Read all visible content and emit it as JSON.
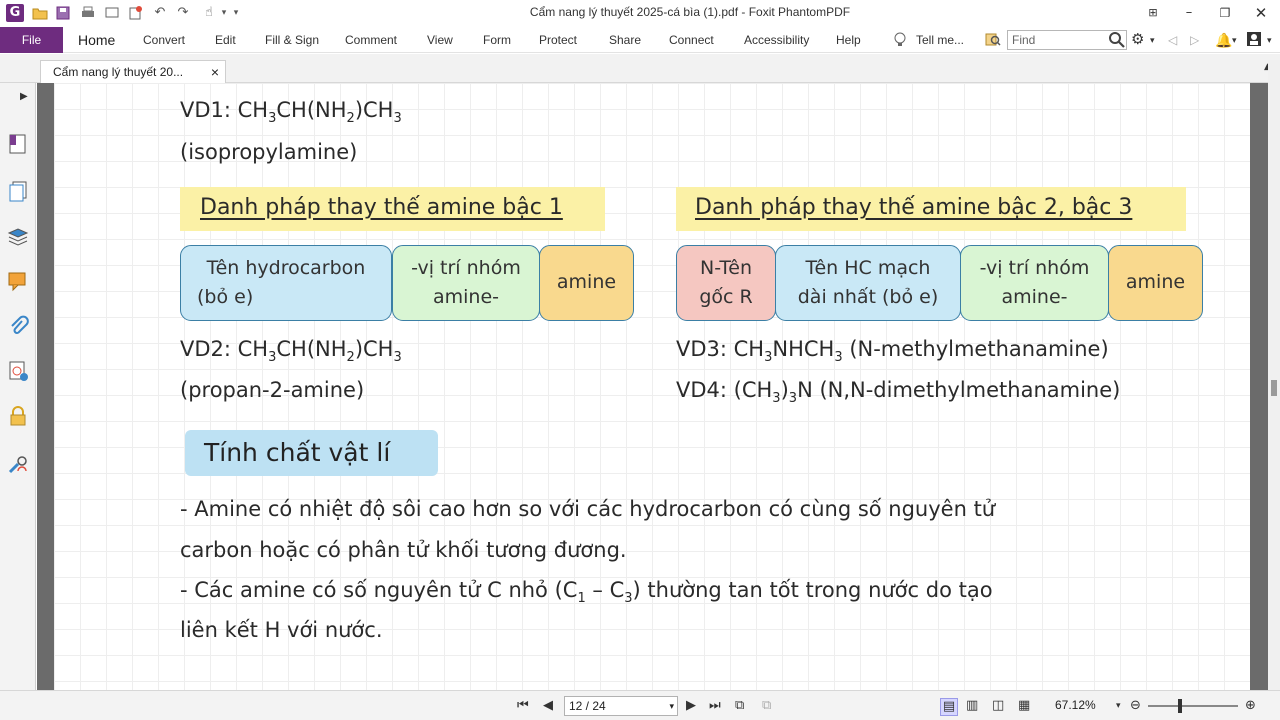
{
  "app": {
    "icon_letter": "G",
    "window_title": "Cẩm nang lý thuyết 2025-cá bìa (1).pdf - Foxit PhantomPDF"
  },
  "menu": {
    "file": "File",
    "items": [
      "Home",
      "Convert",
      "Edit",
      "Fill & Sign",
      "Comment",
      "View",
      "Form",
      "Protect",
      "Share",
      "Connect",
      "Accessibility",
      "Help"
    ],
    "tell_me": "Tell me...",
    "find_placeholder": "Find"
  },
  "tab": {
    "title": "Cẩm nang lý thuyết 20...",
    "close": "×"
  },
  "content": {
    "vd1": {
      "prefix": "VD1: CH",
      "s1": "3",
      "m1": "CH(NH",
      "s2": "2",
      "m2": ")CH",
      "s3": "3",
      "name": "(isopropylamine)"
    },
    "heading_left": "Danh pháp thay thế amine bậc 1",
    "heading_right": "Danh pháp thay thế amine bậc 2, bậc 3",
    "boxes_left": [
      {
        "line1": "Tên hydrocarbon",
        "line2": "(bỏ e)"
      },
      {
        "line1": "-vị trí nhóm",
        "line2": "amine-"
      },
      {
        "line1": "amine",
        "line2": ""
      }
    ],
    "boxes_right": [
      {
        "line1": "N-Tên",
        "line2": "gốc R"
      },
      {
        "line1": "Tên HC mạch",
        "line2": "dài nhất (bỏ e)"
      },
      {
        "line1": "-vị trí nhóm",
        "line2": "amine-"
      },
      {
        "line1": "amine",
        "line2": ""
      }
    ],
    "vd2": {
      "prefix": "VD2: CH",
      "s1": "3",
      "m1": "CH(NH",
      "s2": "2",
      "m2": ")CH",
      "s3": "3",
      "name": "(propan-2-amine)"
    },
    "vd3": {
      "prefix": "VD3: CH",
      "s1": "3",
      "m1": "NHCH",
      "s2": "3",
      "tail": " (N-methylmethanamine)"
    },
    "vd4": {
      "prefix": "VD4: (CH",
      "s1": "3",
      "m1": ")",
      "s2": "3",
      "tail": "N (N,N-dimethylmethanamine)"
    },
    "section_title": "Tính chất vật lí",
    "para1_line1": "- Amine có nhiệt độ sôi cao hơn so với các hydrocarbon có cùng số nguyên tử",
    "para1_line2": "carbon hoặc có phân tử khối tương đương.",
    "para2": {
      "a": "- Các amine có số nguyên tử C nhỏ (C",
      "s1": "1",
      "b": " – C",
      "s2": "3",
      "c": ") thường tan tốt trong nước do tạo"
    },
    "para2_line2": "liên kết H với nước."
  },
  "statusbar": {
    "page_value": "12 / 24",
    "zoom": "67.12%"
  },
  "colors": {
    "brand": "#6e2c7f",
    "heading_band": "#fbf1a6",
    "box_blue": "#c9e8f6",
    "box_green": "#d9f5d3",
    "box_orange": "#f9d98e",
    "box_pink": "#f5c7c1",
    "section_badge": "#bde1f3"
  }
}
